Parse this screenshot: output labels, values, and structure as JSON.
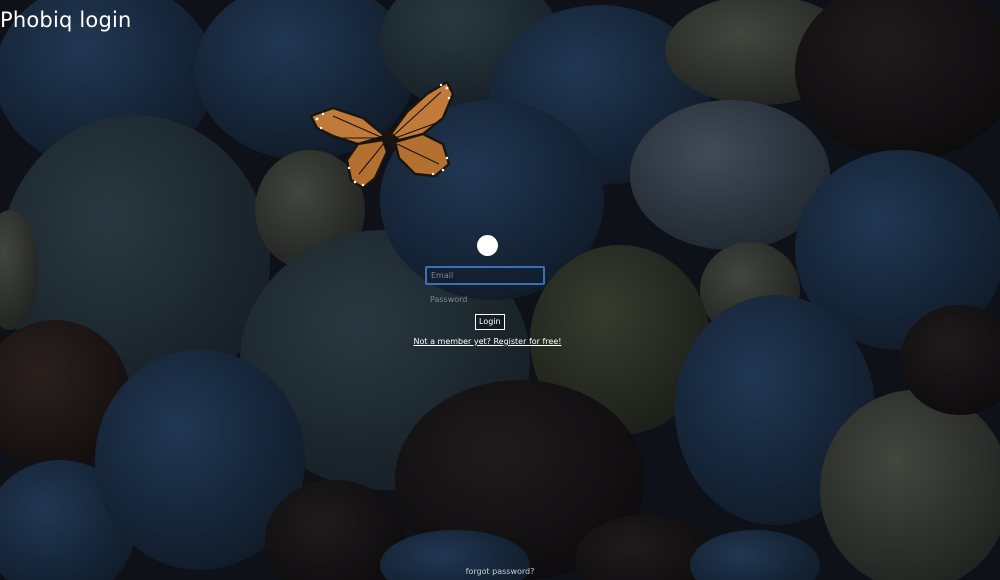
{
  "page": {
    "title": "Phobiq login"
  },
  "login": {
    "email_placeholder": "Email",
    "email_value": "",
    "password_placeholder": "Password",
    "password_value": "",
    "login_label": "Login",
    "register_label": "Not a member yet? Register for free!"
  },
  "footer": {
    "forgot_label": "forgot password?"
  },
  "colors": {
    "focus_border": "#3b6fb7",
    "text": "#ffffff",
    "background": "#141a22"
  },
  "icons": {
    "decoration": "butterfly-icon",
    "avatar": "avatar-dot-icon"
  }
}
